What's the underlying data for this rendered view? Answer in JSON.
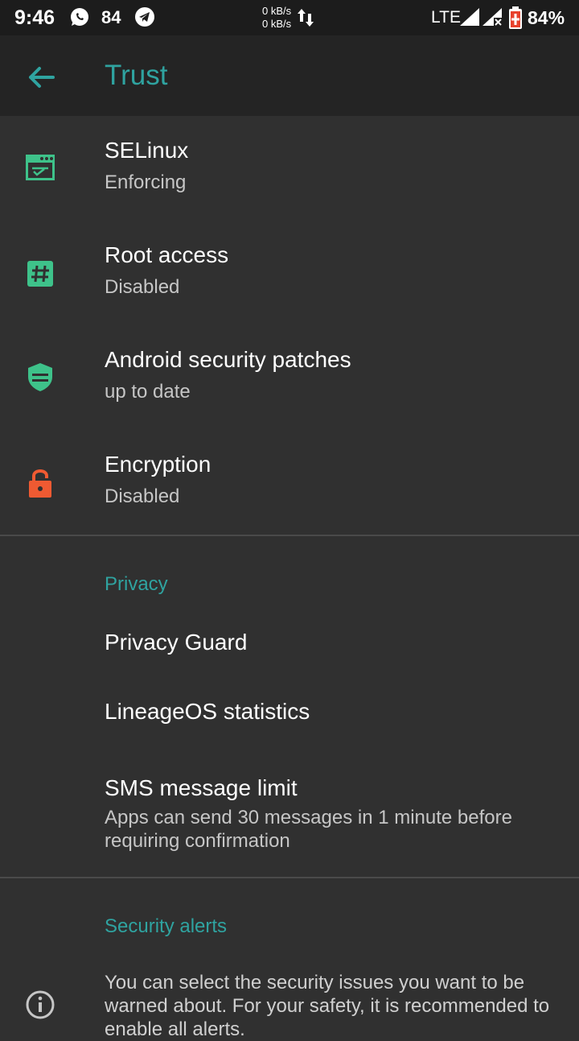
{
  "status_bar": {
    "time": "9:46",
    "notification_count": "84",
    "speed_up": "0 kB/s",
    "speed_down": "0 kB/s",
    "network": "LTE",
    "battery": "84%"
  },
  "app_bar": {
    "title": "Trust"
  },
  "trust_items": [
    {
      "title": "SELinux",
      "subtitle": "Enforcing",
      "icon": "selinux-icon",
      "color": "#3ec28a"
    },
    {
      "title": "Root access",
      "subtitle": "Disabled",
      "icon": "hash-icon",
      "color": "#3ec28a"
    },
    {
      "title": "Android security patches",
      "subtitle": "up to date",
      "icon": "shield-icon",
      "color": "#3ec28a"
    },
    {
      "title": "Encryption",
      "subtitle": "Disabled",
      "icon": "lock-icon",
      "color": "#ef5a32"
    }
  ],
  "privacy": {
    "header": "Privacy",
    "items": [
      {
        "title": "Privacy Guard"
      },
      {
        "title": "LineageOS statistics"
      },
      {
        "title": "SMS message limit",
        "subtitle": "Apps can send 30 messages in 1 minute before requiring confirmation"
      }
    ]
  },
  "security_alerts": {
    "header": "Security alerts",
    "description": "You can select the security issues you want to be warned about. For your safety, it is recommended to enable all alerts."
  },
  "colors": {
    "accent": "#2fa3a0",
    "background": "#303030",
    "appbar": "#242424"
  }
}
